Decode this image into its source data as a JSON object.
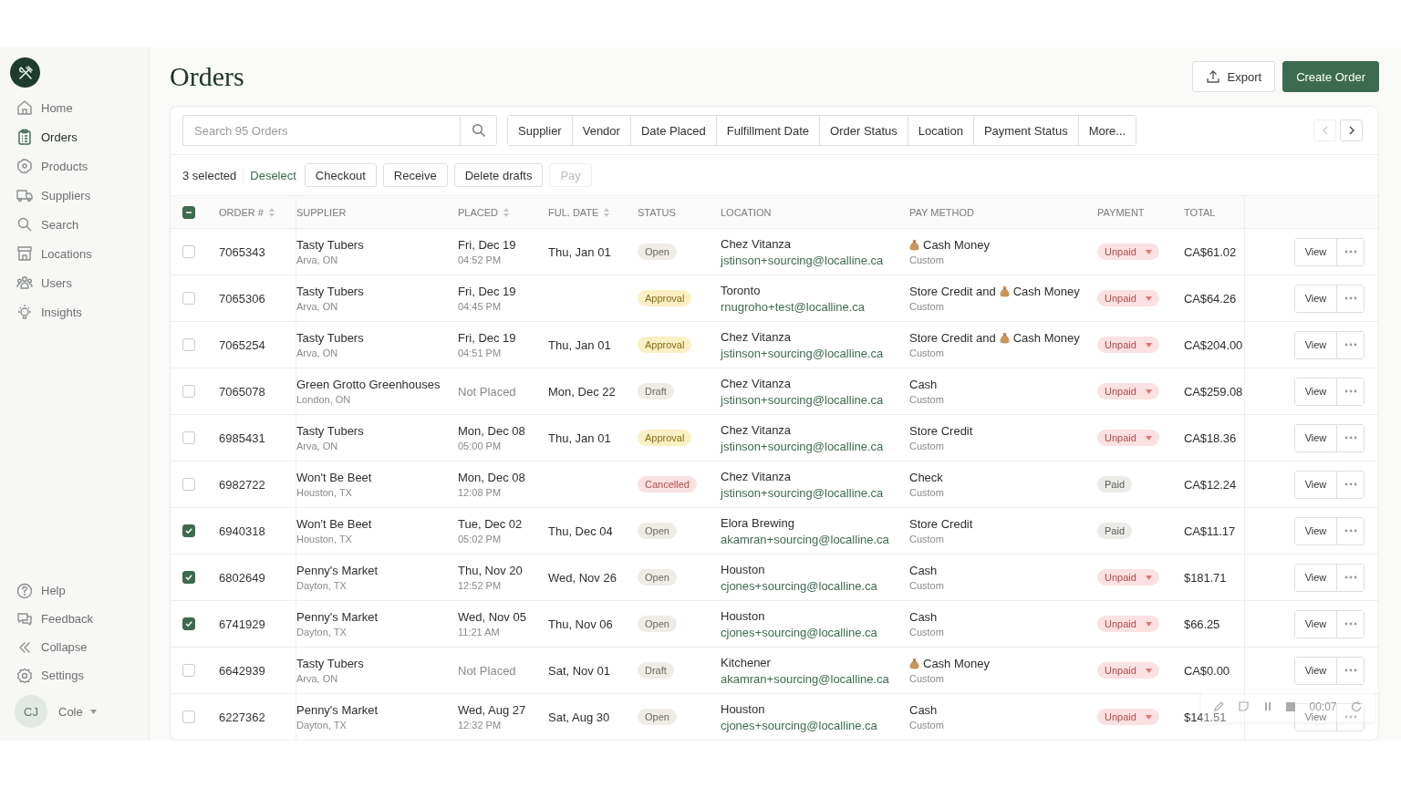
{
  "sidebar": {
    "nav": [
      {
        "label": "Home",
        "selected": false
      },
      {
        "label": "Orders",
        "selected": true
      },
      {
        "label": "Products",
        "selected": false
      },
      {
        "label": "Suppliers",
        "selected": false
      },
      {
        "label": "Search",
        "selected": false
      },
      {
        "label": "Locations",
        "selected": false
      },
      {
        "label": "Users",
        "selected": false
      },
      {
        "label": "Insights",
        "selected": false
      }
    ],
    "footer": [
      {
        "label": "Help"
      },
      {
        "label": "Feedback"
      },
      {
        "label": "Collapse"
      },
      {
        "label": "Settings"
      }
    ],
    "user": {
      "initials": "CJ",
      "name": "Cole"
    }
  },
  "header": {
    "title": "Orders",
    "export": "Export",
    "create": "Create Order"
  },
  "toolbar": {
    "search_placeholder": "Search 95 Orders",
    "filters": [
      "Supplier",
      "Vendor",
      "Date Placed",
      "Fulfillment Date",
      "Order Status",
      "Location",
      "Payment Status",
      "More..."
    ],
    "prev_disabled": true,
    "next_disabled": false
  },
  "selection": {
    "count": "3 selected",
    "deselect": "Deselect",
    "actions": [
      {
        "label": "Checkout",
        "disabled": false
      },
      {
        "label": "Receive",
        "disabled": false
      },
      {
        "label": "Delete drafts",
        "disabled": false
      },
      {
        "label": "Pay",
        "disabled": true
      }
    ]
  },
  "table": {
    "select_all_partial": true,
    "columns": [
      {
        "label": "ORDER #",
        "sortable": true
      },
      {
        "label": "SUPPLIER",
        "sortable": false
      },
      {
        "label": "PLACED",
        "sortable": true
      },
      {
        "label": "FUL. DATE",
        "sortable": true
      },
      {
        "label": "STATUS",
        "sortable": false
      },
      {
        "label": "LOCATION",
        "sortable": false
      },
      {
        "label": "PAY METHOD",
        "sortable": false
      },
      {
        "label": "PAYMENT",
        "sortable": false
      },
      {
        "label": "TOTAL",
        "sortable": false
      }
    ],
    "rows": [
      {
        "checked": false,
        "order": "7065343",
        "supplier": "Tasty Tubers",
        "supplier_place": "Arva, ON",
        "placed": "Fri, Dec 19",
        "placed_time": "04:52 PM",
        "ful_date": "Thu, Jan 01",
        "status": {
          "label": "Open",
          "kind": "open"
        },
        "location": "Chez Vitanza",
        "email": "jstinson+sourcing@localline.ca",
        "pay": [
          {
            "kind": "money",
            "text": "Cash Money"
          }
        ],
        "pay_sub": "Custom",
        "payment": {
          "label": "Unpaid",
          "kind": "unpaid"
        },
        "total": "CA$61.02",
        "view": "View"
      },
      {
        "checked": false,
        "order": "7065306",
        "supplier": "Tasty Tubers",
        "supplier_place": "Arva, ON",
        "placed": "Fri, Dec 19",
        "placed_time": "04:45 PM",
        "status": {
          "label": "Approval",
          "kind": "approval"
        },
        "location": "Toronto",
        "email": "rnugroho+test@localline.ca",
        "pay": [
          {
            "kind": "text",
            "text": "Store Credit and"
          },
          {
            "kind": "money",
            "text": "Cash Money"
          }
        ],
        "pay_sub": "Custom",
        "payment": {
          "label": "Unpaid",
          "kind": "unpaid"
        },
        "total": "CA$64.26",
        "view": "View"
      },
      {
        "checked": false,
        "order": "7065254",
        "supplier": "Tasty Tubers",
        "supplier_place": "Arva, ON",
        "placed": "Fri, Dec 19",
        "placed_time": "04:51 PM",
        "ful_date": "Thu, Jan 01",
        "status": {
          "label": "Approval",
          "kind": "approval"
        },
        "location": "Chez Vitanza",
        "email": "jstinson+sourcing@localline.ca",
        "pay": [
          {
            "kind": "text",
            "text": "Store Credit and"
          },
          {
            "kind": "money",
            "text": "Cash Money"
          }
        ],
        "pay_sub": "Custom",
        "payment": {
          "label": "Unpaid",
          "kind": "unpaid"
        },
        "total": "CA$204.00",
        "view": "View"
      },
      {
        "checked": false,
        "order": "7065078",
        "supplier": "Green Grotto Greenhouses",
        "supplier_place": "London, ON",
        "placed": "Not Placed",
        "ful_date": "Mon, Dec 22",
        "status": {
          "label": "Draft",
          "kind": "draft"
        },
        "location": "Chez Vitanza",
        "email": "jstinson+sourcing@localline.ca",
        "pay": [
          {
            "kind": "text",
            "text": "Cash"
          }
        ],
        "pay_sub": "Custom",
        "payment": {
          "label": "Unpaid",
          "kind": "unpaid"
        },
        "total": "CA$259.08",
        "view": "View"
      },
      {
        "checked": false,
        "order": "6985431",
        "supplier": "Tasty Tubers",
        "supplier_place": "Arva, ON",
        "placed": "Mon, Dec 08",
        "placed_time": "05:00 PM",
        "ful_date": "Thu, Jan 01",
        "status": {
          "label": "Approval",
          "kind": "approval"
        },
        "location": "Chez Vitanza",
        "email": "jstinson+sourcing@localline.ca",
        "pay": [
          {
            "kind": "text",
            "text": "Store Credit"
          }
        ],
        "pay_sub": "Custom",
        "payment": {
          "label": "Unpaid",
          "kind": "unpaid"
        },
        "total": "CA$18.36",
        "view": "View"
      },
      {
        "checked": false,
        "order": "6982722",
        "supplier": "Won't Be Beet",
        "supplier_place": "Houston, TX",
        "placed": "Mon, Dec 08",
        "placed_time": "12:08 PM",
        "status": {
          "label": "Cancelled",
          "kind": "cancelled"
        },
        "location": "Chez Vitanza",
        "email": "jstinson+sourcing@localline.ca",
        "pay": [
          {
            "kind": "text",
            "text": "Check"
          }
        ],
        "pay_sub": "Custom",
        "payment": {
          "label": "Paid",
          "kind": "paid"
        },
        "total": "CA$12.24",
        "view": "View"
      },
      {
        "checked": true,
        "order": "6940318",
        "supplier": "Won't Be Beet",
        "supplier_place": "Houston, TX",
        "placed": "Tue, Dec 02",
        "placed_time": "05:02 PM",
        "ful_date": "Thu, Dec 04",
        "status": {
          "label": "Open",
          "kind": "open"
        },
        "location": "Elora Brewing",
        "email": "akamran+sourcing@localline.ca",
        "pay": [
          {
            "kind": "text",
            "text": "Store Credit"
          }
        ],
        "pay_sub": "Custom",
        "payment": {
          "label": "Paid",
          "kind": "paid"
        },
        "total": "CA$11.17",
        "view": "View"
      },
      {
        "checked": true,
        "order": "6802649",
        "supplier": "Penny's Market",
        "supplier_place": "Dayton, TX",
        "placed": "Thu, Nov 20",
        "placed_time": "12:52 PM",
        "ful_date": "Wed, Nov 26",
        "status": {
          "label": "Open",
          "kind": "open"
        },
        "location": "Houston",
        "email": "cjones+sourcing@localline.ca",
        "pay": [
          {
            "kind": "text",
            "text": "Cash"
          }
        ],
        "pay_sub": "Custom",
        "payment": {
          "label": "Unpaid",
          "kind": "unpaid"
        },
        "total": "$181.71",
        "view": "View"
      },
      {
        "checked": true,
        "order": "6741929",
        "supplier": "Penny's Market",
        "supplier_place": "Dayton, TX",
        "placed": "Wed, Nov 05",
        "placed_time": "11:21 AM",
        "ful_date": "Thu, Nov 06",
        "status": {
          "label": "Open",
          "kind": "open"
        },
        "location": "Houston",
        "email": "cjones+sourcing@localline.ca",
        "pay": [
          {
            "kind": "text",
            "text": "Cash"
          }
        ],
        "pay_sub": "Custom",
        "payment": {
          "label": "Unpaid",
          "kind": "unpaid"
        },
        "total": "$66.25",
        "view": "View"
      },
      {
        "checked": false,
        "order": "6642939",
        "supplier": "Tasty Tubers",
        "supplier_place": "Arva, ON",
        "placed": "Not Placed",
        "ful_date": "Sat, Nov 01",
        "status": {
          "label": "Draft",
          "kind": "draft"
        },
        "location": "Kitchener",
        "email": "akamran+sourcing@localline.ca",
        "pay": [
          {
            "kind": "money",
            "text": "Cash Money"
          }
        ],
        "pay_sub": "Custom",
        "payment": {
          "label": "Unpaid",
          "kind": "unpaid"
        },
        "total": "CA$0.00",
        "view": "View"
      },
      {
        "checked": false,
        "order": "6227362",
        "supplier": "Penny's Market",
        "supplier_place": "Dayton, TX",
        "placed": "Wed, Aug 27",
        "placed_time": "12:32 PM",
        "ful_date": "Sat, Aug 30",
        "status": {
          "label": "Open",
          "kind": "open"
        },
        "location": "Houston",
        "email": "cjones+sourcing@localline.ca",
        "pay": [
          {
            "kind": "text",
            "text": "Cash"
          }
        ],
        "pay_sub": "Custom",
        "payment": {
          "label": "Unpaid",
          "kind": "unpaid"
        },
        "total": "$141.51",
        "view": "View"
      }
    ]
  },
  "recorder": {
    "time": "00:07"
  }
}
